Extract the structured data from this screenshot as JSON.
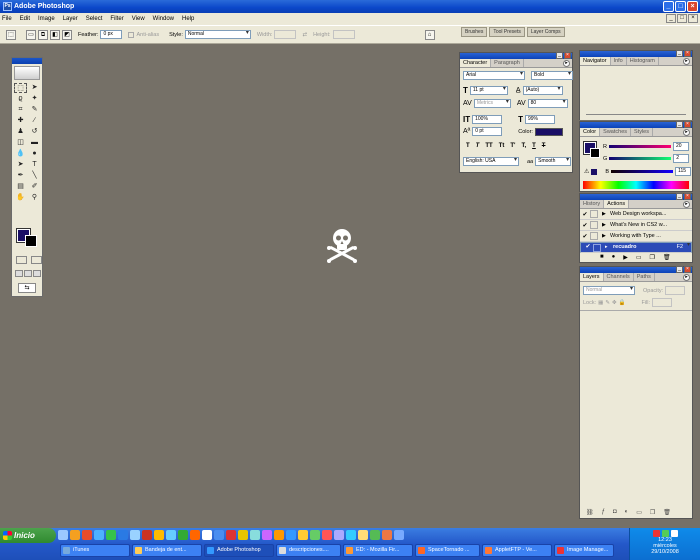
{
  "window": {
    "title": "Adobe Photoshop",
    "logo": "Ps"
  },
  "menu": [
    "File",
    "Edit",
    "Image",
    "Layer",
    "Select",
    "Filter",
    "View",
    "Window",
    "Help"
  ],
  "options": {
    "feather_label": "Feather:",
    "feather_value": "0 px",
    "antialias_label": "Anti-alias",
    "style_label": "Style:",
    "style_value": "Normal",
    "width_label": "Width:",
    "height_label": "Height:"
  },
  "palette_well": [
    "Brushes",
    "Tool Presets",
    "Layer Comps"
  ],
  "character": {
    "tabs": [
      "Character",
      "Paragraph"
    ],
    "font_family": "Arial",
    "font_style": "Bold",
    "font_size": "11 pt",
    "leading": "(Auto)",
    "kerning": "Metrics",
    "tracking": "80",
    "vertical_scale": "100%",
    "horizontal_scale": "99%",
    "baseline_shift": "0 pt",
    "color_label": "Color:",
    "text_color": "#1a0f66",
    "style_buttons": [
      "T",
      "T",
      "TT",
      "Tt",
      "T'",
      "T,",
      "T",
      "T"
    ],
    "language": "English: USA",
    "antialias": "Smooth",
    "aa_label": "aa"
  },
  "navigator": {
    "tabs": [
      "Navigator",
      "Info",
      "Histogram"
    ]
  },
  "color": {
    "tabs": [
      "Color",
      "Swatches",
      "Styles"
    ],
    "r_label": "R",
    "g_label": "G",
    "b_label": "B",
    "r": "20",
    "g": "2",
    "b": "115"
  },
  "actions": {
    "tabs": [
      "History",
      "Actions"
    ],
    "items": [
      "Web Design workspa...",
      "What's New in CS2 w...",
      "Working with Type ...",
      "recuadro"
    ],
    "selected_shortcut": "F2"
  },
  "layers": {
    "tabs": [
      "Layers",
      "Channels",
      "Paths"
    ],
    "blend_mode": "Normal",
    "opacity_label": "Opacity:",
    "lock_label": "Lock:",
    "fill_label": "Fill:"
  },
  "taskbar": {
    "start_label": "Inicio",
    "tasks": [
      {
        "label": "iTunes",
        "w": 70
      },
      {
        "label": "Bandeja de ent...",
        "w": 70
      },
      {
        "label": "Adobe Photoshop",
        "w": 70,
        "active": true
      },
      {
        "label": "descripciones....",
        "w": 65
      },
      {
        "label": "ED: - Mozilla Fir...",
        "w": 70
      },
      {
        "label": "SpaceTornado ...",
        "w": 65
      },
      {
        "label": "AppletFTP - Ve...",
        "w": 70
      },
      {
        "label": "Image Manage...",
        "w": 60
      }
    ],
    "time": "12:23",
    "day": "miércoles",
    "date": "29/10/2008"
  }
}
